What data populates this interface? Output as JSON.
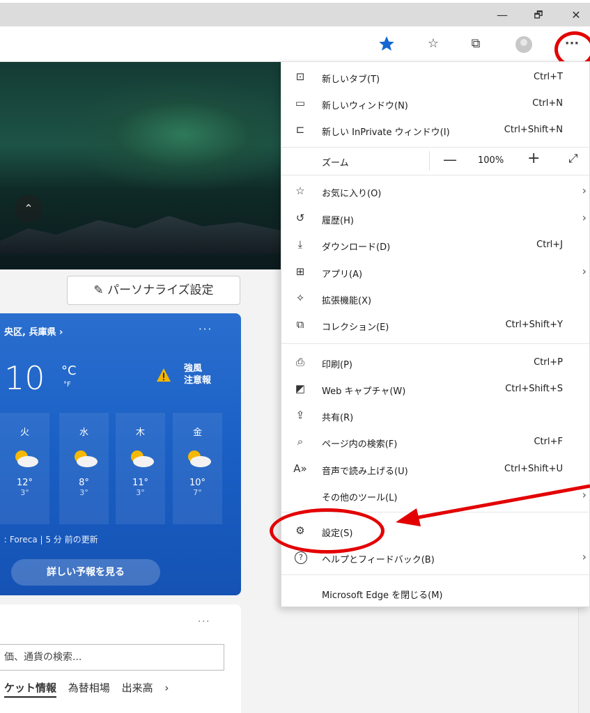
{
  "window": {
    "minimize": "—",
    "maximize": "🗗",
    "close": "✕"
  },
  "toolbar": {
    "more": "···"
  },
  "hero": {
    "collapse": "⌃"
  },
  "personalize": {
    "label": "✎ パーソナライズ設定"
  },
  "weather": {
    "location": "央区, 兵庫県 ›",
    "more": "···",
    "temp": "10",
    "unit_c": "°C",
    "unit_f": "°F",
    "warning": [
      "強風",
      "注意報"
    ],
    "days": [
      {
        "name": "火",
        "hi": "12°",
        "lo": "3°"
      },
      {
        "name": "水",
        "hi": "8°",
        "lo": "3°"
      },
      {
        "name": "木",
        "hi": "11°",
        "lo": "3°"
      },
      {
        "name": "金",
        "hi": "10°",
        "lo": "7°"
      }
    ],
    "source": "ː Foreca | 5 分 前の更新",
    "button": "詳しい予報を見る"
  },
  "market": {
    "more": "···",
    "search_placeholder": "価、通貨の検索...",
    "tabs": [
      "ケット情報",
      "為替相場",
      "出来高",
      "›"
    ]
  },
  "menu": {
    "new_tab": {
      "icon": "⊡",
      "label": "新しいタブ(T)",
      "shortcut": "Ctrl+T"
    },
    "new_window": {
      "icon": "▭",
      "label": "新しいウィンドウ(N)",
      "shortcut": "Ctrl+N"
    },
    "inprivate": {
      "icon": "⊏",
      "label": "新しい InPrivate ウィンドウ(I)",
      "shortcut": "Ctrl+Shift+N"
    },
    "zoom": {
      "label": "ズーム",
      "minus": "—",
      "value": "100%",
      "plus": "+",
      "fullscreen": "⤢"
    },
    "favorites": {
      "icon": "☆",
      "label": "お気に入り(O)",
      "arrow": "›"
    },
    "history": {
      "icon": "↺",
      "label": "履歴(H)",
      "arrow": "›"
    },
    "downloads": {
      "icon": "⤓",
      "label": "ダウンロード(D)",
      "shortcut": "Ctrl+J"
    },
    "apps": {
      "icon": "⊞",
      "label": "アプリ(A)",
      "arrow": "›"
    },
    "extensions": {
      "icon": "✧",
      "label": "拡張機能(X)"
    },
    "collections": {
      "icon": "⧉",
      "label": "コレクション(E)",
      "shortcut": "Ctrl+Shift+Y"
    },
    "print": {
      "icon": "⎙",
      "label": "印刷(P)",
      "shortcut": "Ctrl+P"
    },
    "capture": {
      "icon": "◩",
      "label": "Web キャプチャ(W)",
      "shortcut": "Ctrl+Shift+S"
    },
    "share": {
      "icon": "⇪",
      "label": "共有(R)"
    },
    "find": {
      "icon": "⌕",
      "label": "ページ内の検索(F)",
      "shortcut": "Ctrl+F"
    },
    "read_aloud": {
      "icon": "A»",
      "label": "音声で読み上げる(U)",
      "shortcut": "Ctrl+Shift+U"
    },
    "more_tools": {
      "label": "その他のツール(L)",
      "arrow": "›"
    },
    "settings": {
      "icon": "⚙",
      "label": "設定(S)"
    },
    "help": {
      "icon": "?",
      "label": "ヘルプとフィードバック(B)",
      "arrow": "›"
    },
    "close_edge": {
      "label": "Microsoft Edge を閉じる(M)"
    }
  },
  "colors": {
    "annotation": "#e30000",
    "weather_bg": "#1a5fc4",
    "favorite_star": "#1467d1"
  }
}
